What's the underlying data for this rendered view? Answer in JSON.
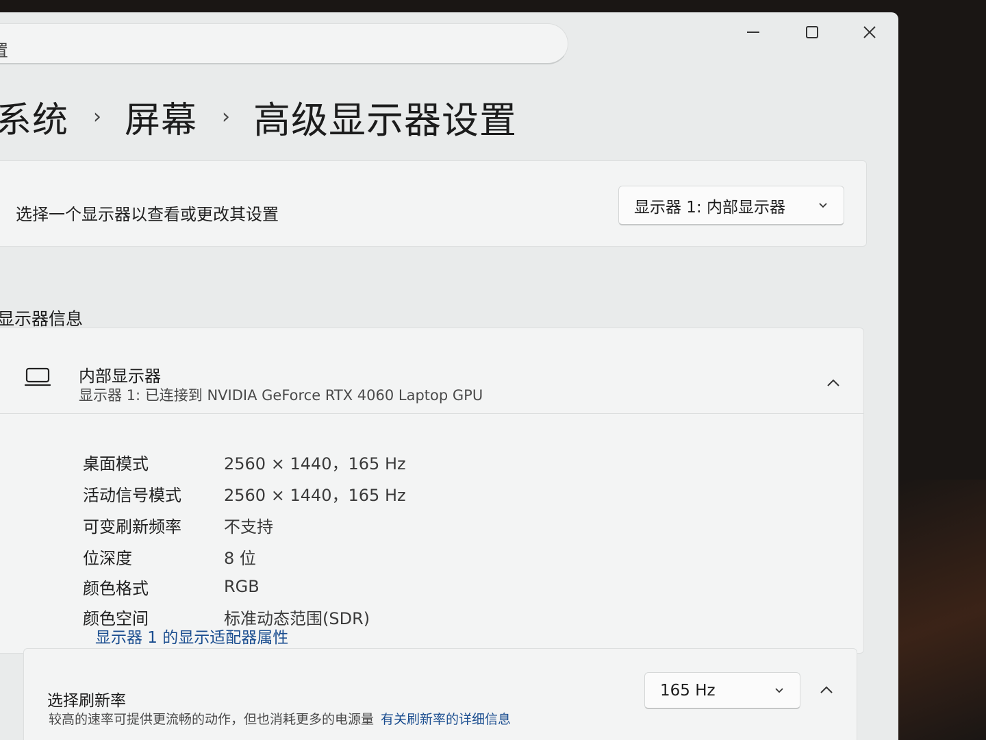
{
  "window": {
    "search_text": "置",
    "minimize_icon": "minimize-icon",
    "maximize_icon": "maximize-icon",
    "close_icon": "close-icon"
  },
  "breadcrumb": {
    "items": [
      "系统",
      "屏幕",
      "高级显示器设置"
    ]
  },
  "display_picker": {
    "label": "选择一个显示器以查看或更改其设置",
    "selected": "显示器 1: 内部显示器"
  },
  "display_info": {
    "section_title": "显示器信息",
    "name": "内部显示器",
    "subtitle": "显示器 1: 已连接到 NVIDIA GeForce RTX 4060 Laptop GPU",
    "specs": [
      {
        "label": "桌面模式",
        "value": "2560 × 1440，165 Hz"
      },
      {
        "label": "活动信号模式",
        "value": "2560 × 1440，165 Hz"
      },
      {
        "label": "可变刷新频率",
        "value": "不支持"
      },
      {
        "label": "位深度",
        "value": "8 位"
      },
      {
        "label": "颜色格式",
        "value": "RGB"
      },
      {
        "label": "颜色空间",
        "value": "标准动态范围(SDR)"
      }
    ],
    "adapter_link": "显示器 1 的显示适配器属性"
  },
  "refresh_rate": {
    "title": "选择刷新率",
    "description": "较高的速率可提供更流畅的动作，但也消耗更多的电源量",
    "link": "有关刷新率的详细信息",
    "selected": "165 Hz"
  }
}
